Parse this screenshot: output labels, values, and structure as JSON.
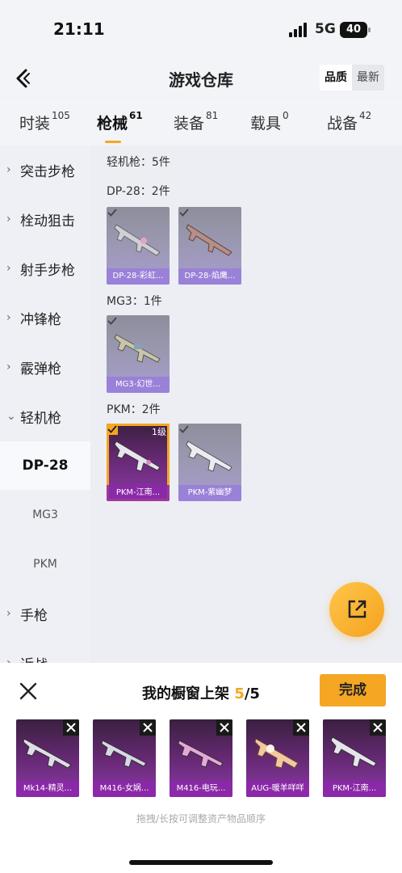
{
  "status": {
    "time": "21:11",
    "network": "5G",
    "battery": "40"
  },
  "header": {
    "title": "游戏仓库",
    "sort_options": [
      "品质",
      "最新"
    ],
    "sort_selected": "品质"
  },
  "tabs": [
    {
      "label": "时装",
      "count": "105"
    },
    {
      "label": "枪械",
      "count": "61"
    },
    {
      "label": "装备",
      "count": "81"
    },
    {
      "label": "载具",
      "count": "0"
    },
    {
      "label": "战备",
      "count": "42"
    }
  ],
  "sidebar": {
    "items": [
      {
        "label": "突击步枪"
      },
      {
        "label": "栓动狙击"
      },
      {
        "label": "射手步枪"
      },
      {
        "label": "冲锋枪"
      },
      {
        "label": "霰弹枪"
      },
      {
        "label": "轻机枪"
      },
      {
        "label": "DP-28"
      },
      {
        "label": "MG3"
      },
      {
        "label": "PKM"
      },
      {
        "label": "手枪"
      },
      {
        "label": "近战"
      }
    ]
  },
  "content": {
    "category_header": "轻机枪：5件",
    "groups": [
      {
        "label": "DP-28：2件",
        "items": [
          {
            "name": "DP-28-彩虹..."
          },
          {
            "name": "DP-28-焰鹰..."
          }
        ]
      },
      {
        "label": "MG3：1件",
        "items": [
          {
            "name": "MG3-幻世..."
          }
        ]
      },
      {
        "label": "PKM：2件",
        "items": [
          {
            "name": "PKM-江南...",
            "level": "1级"
          },
          {
            "name": "PKM-紫幽梦"
          }
        ]
      }
    ]
  },
  "panel": {
    "title_prefix": "我的橱窗上架",
    "count_current": "5",
    "count_total": "/5",
    "done_label": "完成",
    "items": [
      {
        "name": "Mk14-精灵..."
      },
      {
        "name": "M416-女娲..."
      },
      {
        "name": "M416-电玩..."
      },
      {
        "name": "AUG-暖羊咩咩"
      },
      {
        "name": "PKM-江南..."
      }
    ],
    "hint": "拖拽/长按可调整资产物品顺序"
  },
  "colors": {
    "accent": "#f5a623",
    "purple": "#8a3aa6"
  }
}
